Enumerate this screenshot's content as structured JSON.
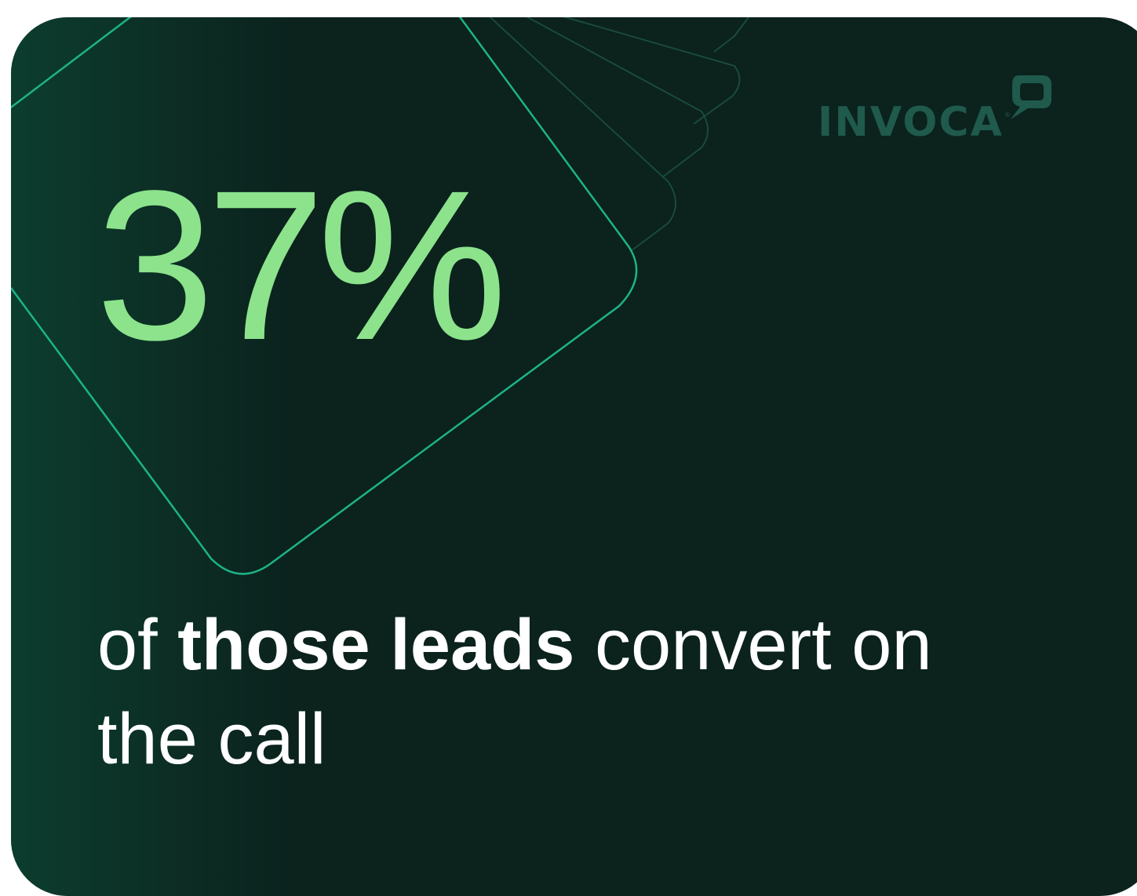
{
  "brand": {
    "name": "INVOCA",
    "registered_mark": "®",
    "logo_color": "#1f5a4c"
  },
  "stat": {
    "value": "37%",
    "color": "#8ce38c"
  },
  "caption": {
    "prefix": "of ",
    "emphasis": "those leads",
    "suffix_line1": " convert on",
    "line2": "the call"
  },
  "colors": {
    "background": "#0b221d",
    "outline_accent": "#1db386",
    "outline_muted": "#1a4a3d"
  }
}
